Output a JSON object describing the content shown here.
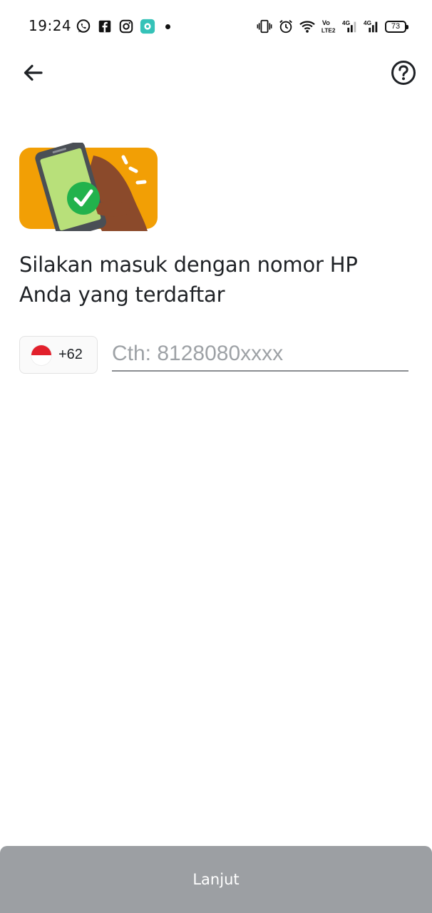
{
  "status_bar": {
    "time": "19:24",
    "left_icons": [
      "whatsapp-icon",
      "facebook-icon",
      "instagram-icon",
      "app-notification-icon"
    ],
    "right_icons": [
      "vibrate-icon",
      "alarm-icon",
      "wifi-icon",
      "volte-icon",
      "signal-4g-1-icon",
      "signal-4g-2-icon"
    ],
    "volte_label": "Vo\nLTE2",
    "network_label": "4G",
    "battery_level": "73"
  },
  "app_bar": {
    "back_icon": "arrow-left-icon",
    "help_icon": "question-circle-icon"
  },
  "colors": {
    "illustration_bg": "#F29F05",
    "phone_screen": "#B8E07A",
    "check_circle": "#22B24C",
    "button_disabled": "#9C9FA3"
  },
  "login": {
    "heading": "Silakan masuk dengan nomor HP Anda yang terdaftar",
    "country_code": "+62",
    "country_flag": "indonesia-flag-icon",
    "phone_value": "",
    "phone_placeholder": "Cth: 8128080xxxx"
  },
  "footer": {
    "continue_label": "Lanjut"
  }
}
